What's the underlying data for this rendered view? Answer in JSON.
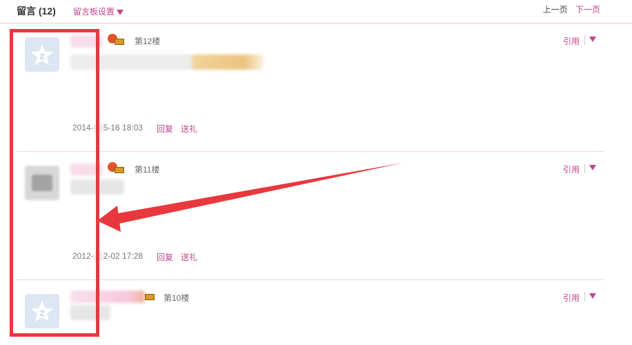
{
  "header": {
    "title": "留言",
    "count": "(12)",
    "board_settings": "留言板设置",
    "prev_page": "上一页",
    "next_page": "下一页"
  },
  "entries": [
    {
      "floor": "第12楼",
      "timestamp_a": "2014-",
      "timestamp_b": "5-16 18:03",
      "reply": "回复",
      "gift": "送礼",
      "quote": "引用",
      "avatar": "qzone-star-avatar"
    },
    {
      "floor": "第11楼",
      "timestamp_a": "2012-",
      "timestamp_b": "2-02 17:28",
      "reply": "回复",
      "gift": "送礼",
      "quote": "引用",
      "avatar": "blurred-photo-avatar"
    },
    {
      "floor": "第10楼",
      "quote": "引用",
      "avatar": "qzone-star-avatar"
    }
  ],
  "icons": {
    "vip": "apple-vip-icon",
    "menu": "caret-down-icon",
    "avatar_default": "star-avatar-icon"
  },
  "colors": {
    "accent": "#c0458d",
    "annotation": "#e8383d",
    "header_rule": "#f2c6da",
    "avatar_bg": "#dce7f3"
  }
}
